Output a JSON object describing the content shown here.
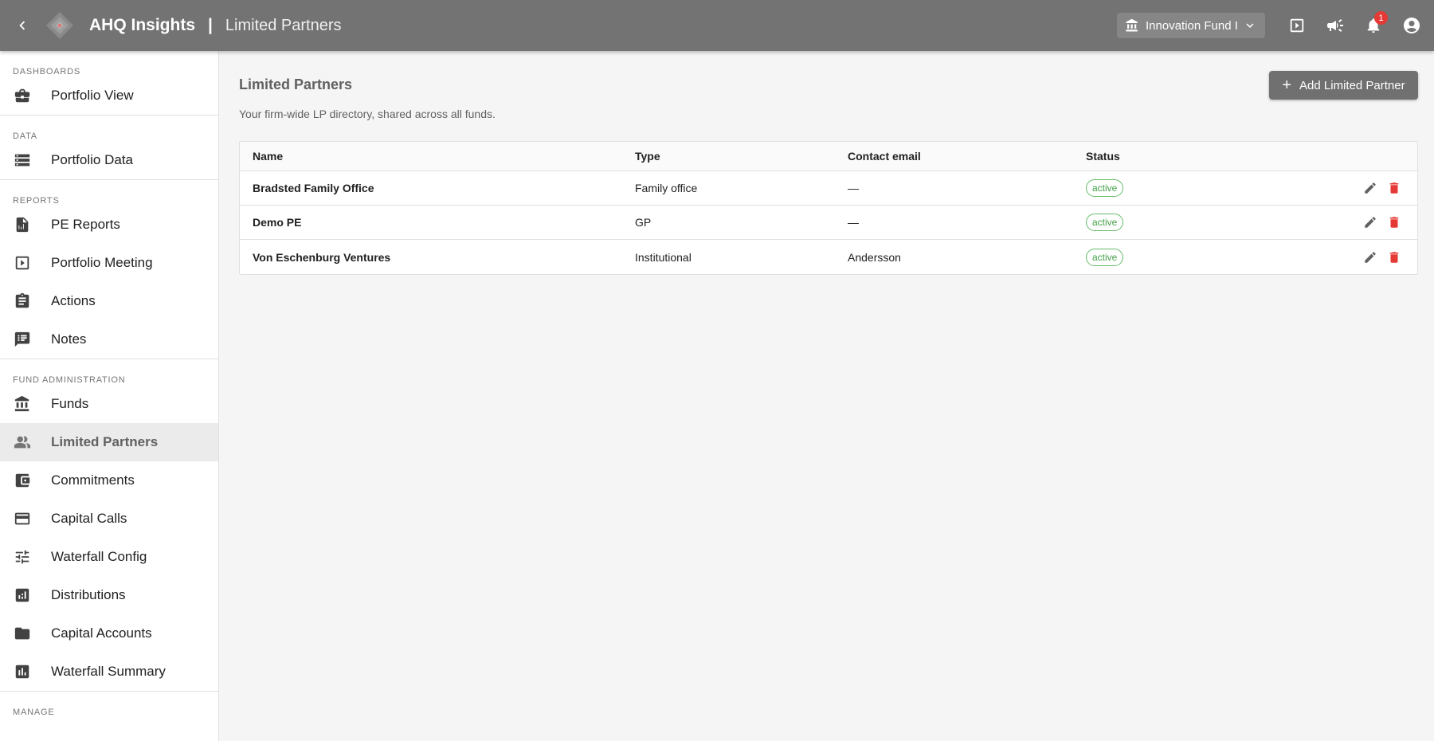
{
  "header": {
    "app_title": "AHQ Insights",
    "separator": "|",
    "page_crumb": "Limited Partners",
    "fund_selector": {
      "value": "Innovation Fund I"
    },
    "notification_count": "1"
  },
  "sidebar": {
    "sections": [
      {
        "label": "DASHBOARDS",
        "items": [
          {
            "label": "Portfolio View",
            "icon": "briefcase-icon"
          }
        ]
      },
      {
        "label": "DATA",
        "items": [
          {
            "label": "Portfolio Data",
            "icon": "storage-icon"
          }
        ]
      },
      {
        "label": "REPORTS",
        "items": [
          {
            "label": "PE Reports",
            "icon": "report-icon"
          },
          {
            "label": "Portfolio Meeting",
            "icon": "slideshow-icon"
          },
          {
            "label": "Actions",
            "icon": "assignment-icon"
          },
          {
            "label": "Notes",
            "icon": "notes-icon"
          }
        ]
      },
      {
        "label": "FUND ADMINISTRATION",
        "items": [
          {
            "label": "Funds",
            "icon": "bank-icon"
          },
          {
            "label": "Limited Partners",
            "icon": "people-icon",
            "active": true
          },
          {
            "label": "Commitments",
            "icon": "wallet-icon"
          },
          {
            "label": "Capital Calls",
            "icon": "credit-card-icon"
          },
          {
            "label": "Waterfall Config",
            "icon": "tune-icon"
          },
          {
            "label": "Distributions",
            "icon": "bar-chart-icon"
          },
          {
            "label": "Capital Accounts",
            "icon": "folder-icon"
          },
          {
            "label": "Waterfall Summary",
            "icon": "assessment-icon"
          }
        ]
      },
      {
        "label": "MANAGE",
        "items": []
      }
    ]
  },
  "main": {
    "title": "Limited Partners",
    "subtitle": "Your firm-wide LP directory, shared across all funds.",
    "add_button": "Add Limited Partner",
    "table": {
      "columns": [
        "Name",
        "Type",
        "Contact email",
        "Status"
      ],
      "rows": [
        {
          "name": "Bradsted Family Office",
          "type": "Family office",
          "email": "—",
          "status": "active"
        },
        {
          "name": "Demo PE",
          "type": "GP",
          "email": "—",
          "status": "active"
        },
        {
          "name": "Von Eschenburg Ventures",
          "type": "Institutional",
          "email": "Andersson",
          "status": "active"
        }
      ]
    }
  },
  "colors": {
    "appbar": "#737373",
    "status_active": "#43a047",
    "delete": "#e53935"
  }
}
